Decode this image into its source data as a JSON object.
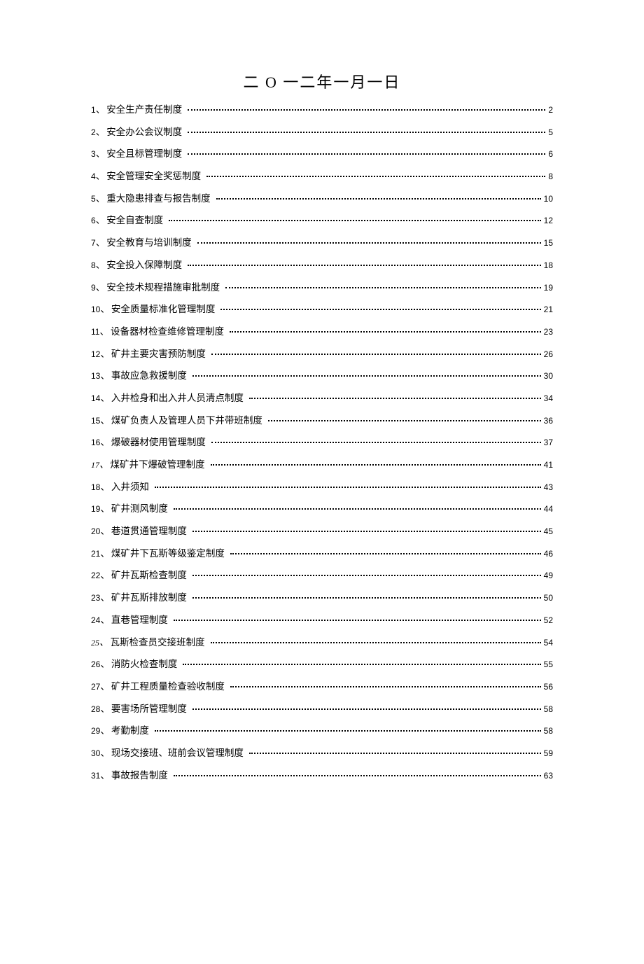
{
  "title": "二 О 一二年一月一日",
  "toc": [
    {
      "num": "1",
      "label": "安全生产责任制度",
      "page": "2",
      "italic": false
    },
    {
      "num": "2",
      "label": "安全办公会议制度",
      "page": "5",
      "italic": false
    },
    {
      "num": "3",
      "label": "安全且标管理制度",
      "page": "6",
      "italic": false
    },
    {
      "num": "4",
      "label": "安全管理安全奖惩制度",
      "page": "8",
      "italic": false
    },
    {
      "num": "5",
      "label": "重大隐患排查与报告制度",
      "page": "10",
      "italic": false
    },
    {
      "num": "6",
      "label": "安全自查制度",
      "page": "12",
      "italic": false
    },
    {
      "num": "7",
      "label": "安全教育与培训制度",
      "page": "15",
      "italic": false
    },
    {
      "num": "8",
      "label": "安全投入保障制度",
      "page": "18",
      "italic": false
    },
    {
      "num": "9",
      "label": "安全技术规程措施审批制度",
      "page": "19",
      "italic": false
    },
    {
      "num": "10",
      "label": "安全质量标准化管理制度",
      "page": "21",
      "italic": false
    },
    {
      "num": "11",
      "label": "设备器材检查维修管理制度",
      "page": "23",
      "italic": false
    },
    {
      "num": "12",
      "label": "矿井主要灾害预防制度",
      "page": "26",
      "italic": false
    },
    {
      "num": "13",
      "label": "事故应急救援制度",
      "page": "30",
      "italic": false
    },
    {
      "num": "14",
      "label": "入井检身和出入井人员清点制度",
      "page": "34",
      "italic": false
    },
    {
      "num": "15",
      "label": "煤矿负责人及管理人员下井带班制度",
      "page": "36",
      "italic": false
    },
    {
      "num": "16",
      "label": "爆破器材使用管理制度",
      "page": "37",
      "italic": false
    },
    {
      "num": "17",
      "label": "煤矿井下爆破管理制度",
      "page": "41",
      "italic": true
    },
    {
      "num": "18",
      "label": "入井须知",
      "page": "43",
      "italic": false
    },
    {
      "num": "19",
      "label": "矿井测风制度",
      "page": "44",
      "italic": false
    },
    {
      "num": "20",
      "label": "巷道贯通管理制度",
      "page": "45",
      "italic": false
    },
    {
      "num": "21",
      "label": "煤矿井下瓦斯等级鉴定制度",
      "page": "46",
      "italic": false
    },
    {
      "num": "22",
      "label": "矿井瓦斯检查制度",
      "page": "49",
      "italic": false
    },
    {
      "num": "23",
      "label": "矿井瓦斯排放制度",
      "page": "50",
      "italic": false
    },
    {
      "num": "24",
      "label": "直巷管理制度",
      "page": "52",
      "italic": false
    },
    {
      "num": "25",
      "label": "瓦斯检查员交接班制度",
      "page": "54",
      "italic": true
    },
    {
      "num": "26",
      "label": "消防火检查制度",
      "page": "55",
      "italic": false
    },
    {
      "num": "27",
      "label": "矿井工程质量检查验收制度",
      "page": "56",
      "italic": false
    },
    {
      "num": "28",
      "label": "要害场所管理制度",
      "page": "58",
      "italic": false
    },
    {
      "num": "29",
      "label": "考勤制度",
      "page": "58",
      "italic": false
    },
    {
      "num": "30",
      "label": "现场交接班、班前会议管理制度",
      "page": "59",
      "italic": false
    },
    {
      "num": "31",
      "label": "事故报告制度",
      "page": "63",
      "italic": false
    }
  ]
}
